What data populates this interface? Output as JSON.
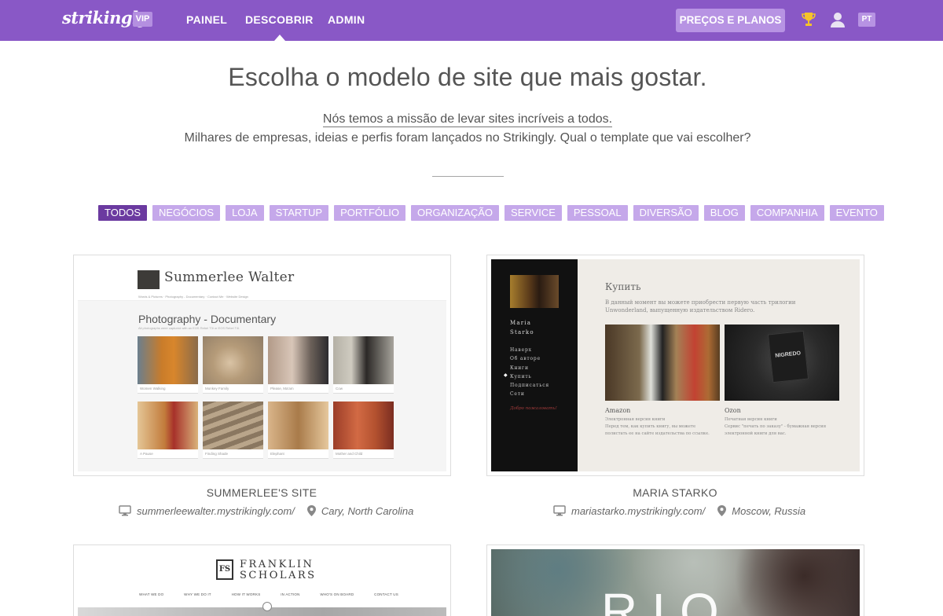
{
  "header": {
    "logo": "strikingly",
    "vip_badge": "VIP",
    "nav": [
      "PAINEL",
      "DESCOBRIR",
      "ADMIN"
    ],
    "active_nav": "DESCOBRIR",
    "pricing_button": "PREÇOS E PLANOS",
    "language": "PT",
    "brand_color": "#8958c6",
    "icons": [
      "trophy-icon",
      "user-icon"
    ]
  },
  "hero": {
    "title": "Escolha o modelo de site que mais gostar.",
    "mission": "Nós temos a missão de levar sites incríveis a todos.",
    "subtitle": "Milhares de empresas, ideias e perfis foram lançados no Strikingly. Qual o template que vai escolher?"
  },
  "filters": {
    "items": [
      "TODOS",
      "NEGÓCIOS",
      "LOJA",
      "STARTUP",
      "PORTFÓLIO",
      "ORGANIZAÇÃO",
      "SERVICE",
      "PESSOAL",
      "DIVERSÃO",
      "BLOG",
      "COMPANHIA",
      "EVENTO"
    ],
    "active": "TODOS",
    "active_color": "#6b3aa0",
    "inactive_color": "#c5a8ea"
  },
  "sites": [
    {
      "title": "SUMMERLEE'S SITE",
      "url": "summerleewalter.mystrikingly.com/",
      "location": "Cary, North Carolina",
      "preview": {
        "name": "Summerlee Walter",
        "nav": "Words & Pictures · Photography - Documentary · Contact Me · Website Design",
        "heading": "Photography - Documentary",
        "caption": "All photographs were captured with an EOS Rebel T3i or EOS Rebel T4i.",
        "photos": [
          "Women Walking",
          "Monkey Family",
          "Please, Ma'am",
          "Cow",
          "A Pause",
          "Finding Shade",
          "Elephant",
          "Mother and Child"
        ]
      }
    },
    {
      "title": "MARIA STARKO",
      "url": "mariastarko.mystrikingly.com/",
      "location": "Moscow, Russia",
      "preview": {
        "author_line1": "Maria",
        "author_line2": "Starko",
        "menu": [
          "Наверх",
          "Об авторе",
          "Книги",
          "Купить",
          "Подписаться",
          "Сети"
        ],
        "active_menu": "Купить",
        "welcome": "Добро пожаловать!",
        "heading": "Купить",
        "text": "В данный момент вы можете приобрести первую часть трилогии Unwonderland, выпущенную издательством Ridero.",
        "book_cover": "NIGREDO",
        "store1": {
          "name": "Amazon",
          "line1": "Электронная версия книги",
          "line2": "Перед тем, как купить книгу, вы можете",
          "line3": "полистать ее на сайте издательства по ссылке."
        },
        "store2": {
          "name": "Ozon",
          "line1": "Печатная версия книги",
          "line2": "Сервис \"печать по заказу\" - бумажная версия",
          "line3": "электронной книги для вас."
        }
      }
    },
    {
      "preview": {
        "logo_letters": "FS",
        "name_line1": "FRANKLIN",
        "name_line2": "SCHOLARS",
        "nav": [
          "WHAT WE DO",
          "WHY WE DO IT",
          "HOW IT WORKS",
          "IN ACTION",
          "WHO'S ON BOARD",
          "CONTACT US"
        ]
      }
    },
    {
      "preview": {
        "overlay_text": "RIO"
      }
    }
  ]
}
